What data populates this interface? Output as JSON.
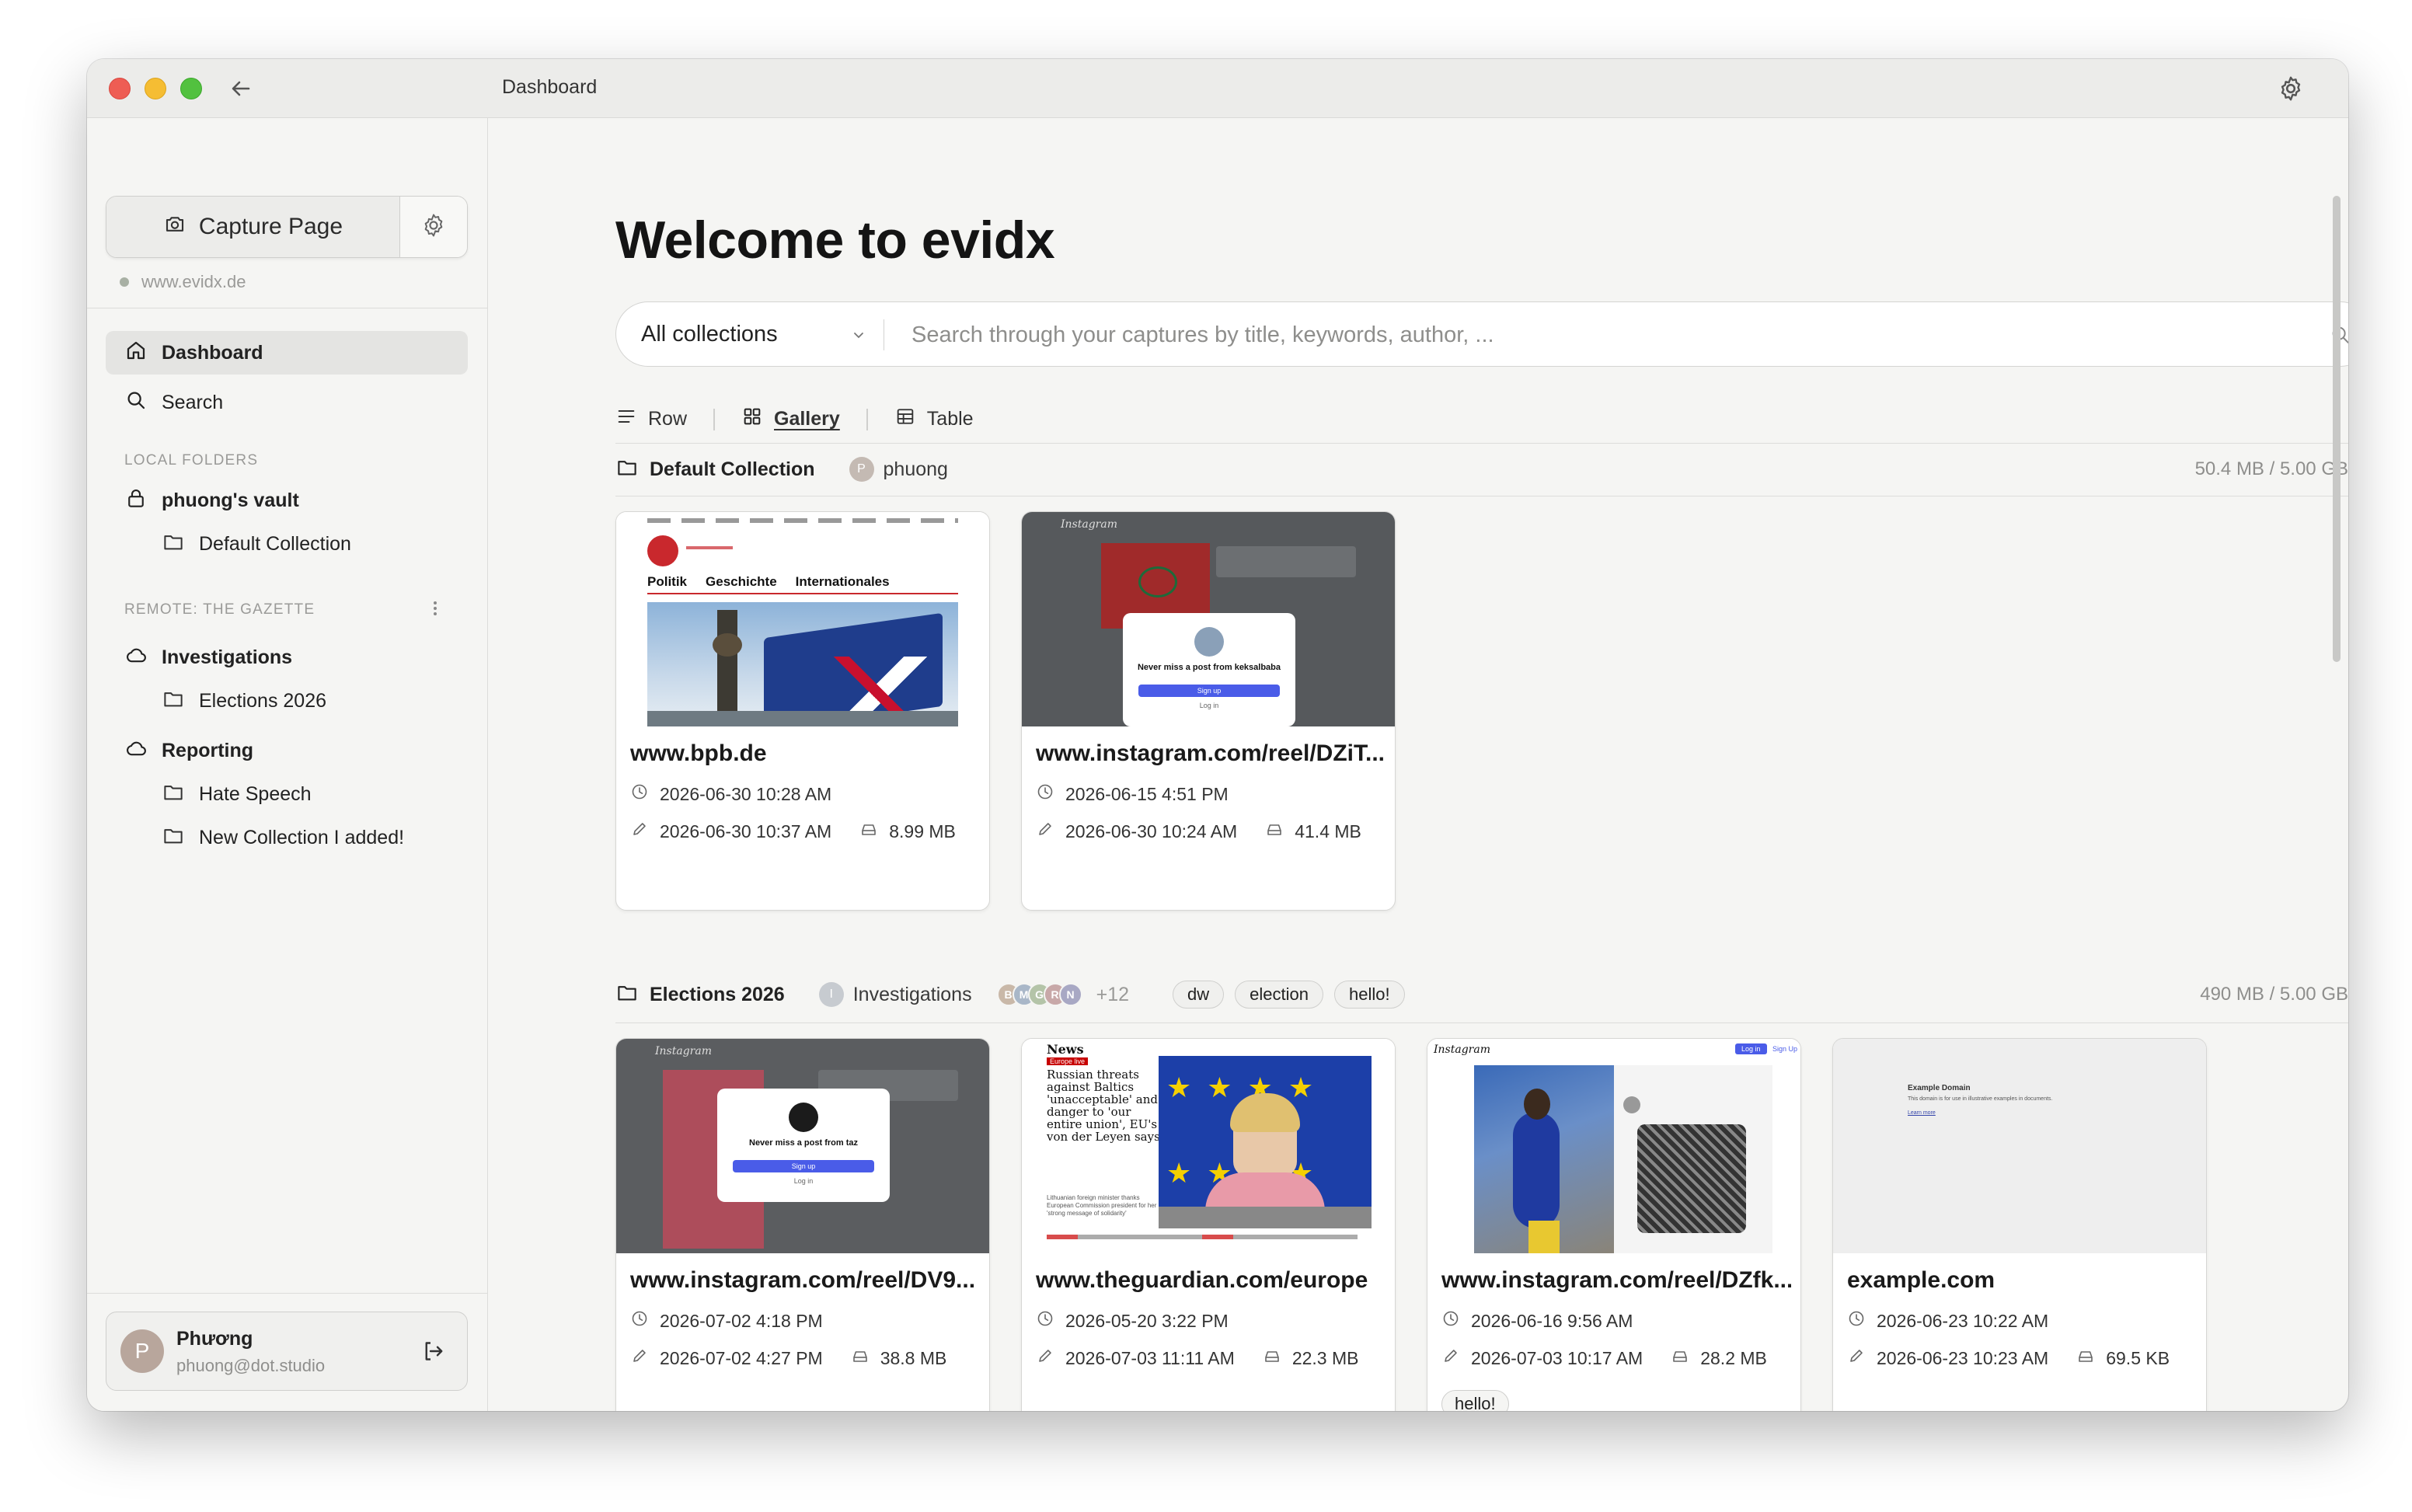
{
  "window": {
    "title": "Dashboard"
  },
  "sidebar": {
    "capture_label": "Capture Page",
    "site": "www.evidx.de",
    "nav": [
      {
        "label": "Dashboard",
        "active": true
      },
      {
        "label": "Search",
        "active": false
      }
    ],
    "local_label": "LOCAL FOLDERS",
    "local": {
      "vault": "phuong's vault",
      "children": [
        "Default Collection"
      ]
    },
    "remote_label": "REMOTE: THE GAZETTE",
    "remote": [
      {
        "label": "Investigations",
        "children": [
          "Elections 2026"
        ]
      },
      {
        "label": "Reporting",
        "children": [
          "Hate Speech",
          "New Collection I added!"
        ]
      }
    ],
    "user": {
      "initial": "P",
      "name": "Phương",
      "email": "phuong@dot.studio"
    }
  },
  "main": {
    "title": "Welcome to evidx",
    "collection_select": "All collections",
    "search_placeholder": "Search through your captures by title, keywords, author, ...",
    "views": [
      "Row",
      "Gallery",
      "Table"
    ],
    "active_view": "Gallery",
    "collections": [
      {
        "name": "Default Collection",
        "owner_initial": "P",
        "owner": "phuong",
        "storage": "50.4 MB / 5.00 GB",
        "cards": [
          {
            "title": "www.bpb.de",
            "captured": "2026-06-30 10:28 AM",
            "edited": "2026-06-30 10:37 AM",
            "size": "8.99 MB",
            "thumb": "bpb"
          },
          {
            "title": "www.instagram.com/reel/DZiT...",
            "captured": "2026-06-15 4:51 PM",
            "edited": "2026-06-30 10:24 AM",
            "size": "41.4 MB",
            "thumb": "insta-modal"
          }
        ]
      },
      {
        "name": "Elections 2026",
        "owner_initial": "I",
        "owner": "Investigations",
        "members": [
          "B",
          "M",
          "G",
          "R",
          "N"
        ],
        "members_more": "+12",
        "tags": [
          "dw",
          "election",
          "hello!"
        ],
        "storage": "490 MB / 5.00 GB",
        "cards": [
          {
            "title": "www.instagram.com/reel/DV9...",
            "captured": "2026-07-02 4:18 PM",
            "edited": "2026-07-02 4:27 PM",
            "size": "38.8 MB",
            "thumb": "insta-taz"
          },
          {
            "title": "www.theguardian.com/europe",
            "captured": "2026-05-20 3:22 PM",
            "edited": "2026-07-03 11:11 AM",
            "size": "22.3 MB",
            "thumb": "guardian"
          },
          {
            "title": "www.instagram.com/reel/DZfk...",
            "captured": "2026-06-16 9:56 AM",
            "edited": "2026-07-03 10:17 AM",
            "size": "28.2 MB",
            "thumb": "insta-reel",
            "tag": "hello!"
          },
          {
            "title": "example.com",
            "captured": "2026-06-23 10:22 AM",
            "edited": "2026-06-23 10:23 AM",
            "size": "69.5 KB",
            "thumb": "example"
          }
        ]
      }
    ]
  },
  "thumbs": {
    "bpb": {
      "nav": [
        "Politik",
        "Geschichte",
        "Internationales"
      ]
    },
    "insta_modal": {
      "logo": "Instagram",
      "prompt": "Never miss a post from keksalbaba",
      "button": "Sign up",
      "link": "Log in"
    },
    "insta_taz": {
      "logo": "Instagram",
      "prompt": "Never miss a post from taz",
      "button": "Sign up",
      "link": "Log in"
    },
    "guardian": {
      "section": "News",
      "badge": "Europe live",
      "headline": "Russian threats against Baltics 'unacceptable' and danger to 'our entire union', EU's von der Leyen says",
      "sub": "Lithuanian foreign minister thanks European Commission president for her 'strong message of solidarity'"
    },
    "insta_reel": {
      "logo": "Instagram",
      "login": "Log in",
      "signup": "Sign Up"
    },
    "example": {
      "heading": "Example Domain",
      "body": "This domain is for use in illustrative examples in documents.",
      "link": "Learn more"
    }
  },
  "colors": {
    "accent": "#4a5ce8",
    "avatar_p": "#b8a69c",
    "member_colors": [
      "#c9b8a8",
      "#a9b7c8",
      "#b4c4a8",
      "#c8a8a8",
      "#a8a8c4"
    ]
  }
}
